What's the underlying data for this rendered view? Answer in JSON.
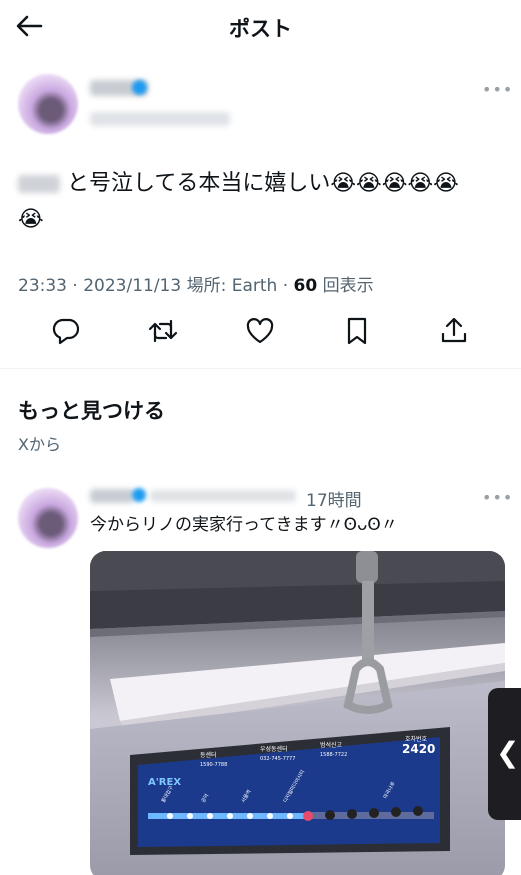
{
  "header": {
    "title": "ポスト",
    "back_icon": "back-arrow-icon"
  },
  "tweet": {
    "text_line1": "と号泣してる本当に嬉しい😭😭😭😭😭",
    "text_line2": "😭",
    "time": "23:33 · 2023/11/13",
    "location": " 場所: Earth · ",
    "views_count": "60",
    "views_label": " 回表示",
    "actions": [
      "reply-icon",
      "retweet-icon",
      "like-icon",
      "bookmark-icon",
      "share-icon"
    ]
  },
  "discover": {
    "title": "もっと見つける",
    "subtitle": "Xから"
  },
  "recommended": {
    "time": "17時間",
    "text": "今からリノの実家行ってきます〃ʘᴗʘ〃",
    "photo": {
      "brand": "A'REX",
      "stations": [
        "홍대입구",
        "공덕",
        "서울역",
        "디지털미디어시티",
        "마곡나루"
      ],
      "board_labels": [
        "동센터",
        "1590-7788",
        "우성동센터",
        "032-745-7777",
        "범석신고",
        "1588-7722",
        "호차번호"
      ],
      "car_number": "2420"
    }
  },
  "colors": {
    "accent": "#1d9bf0",
    "secondary_text": "#536471",
    "divider": "#eff3f4"
  }
}
